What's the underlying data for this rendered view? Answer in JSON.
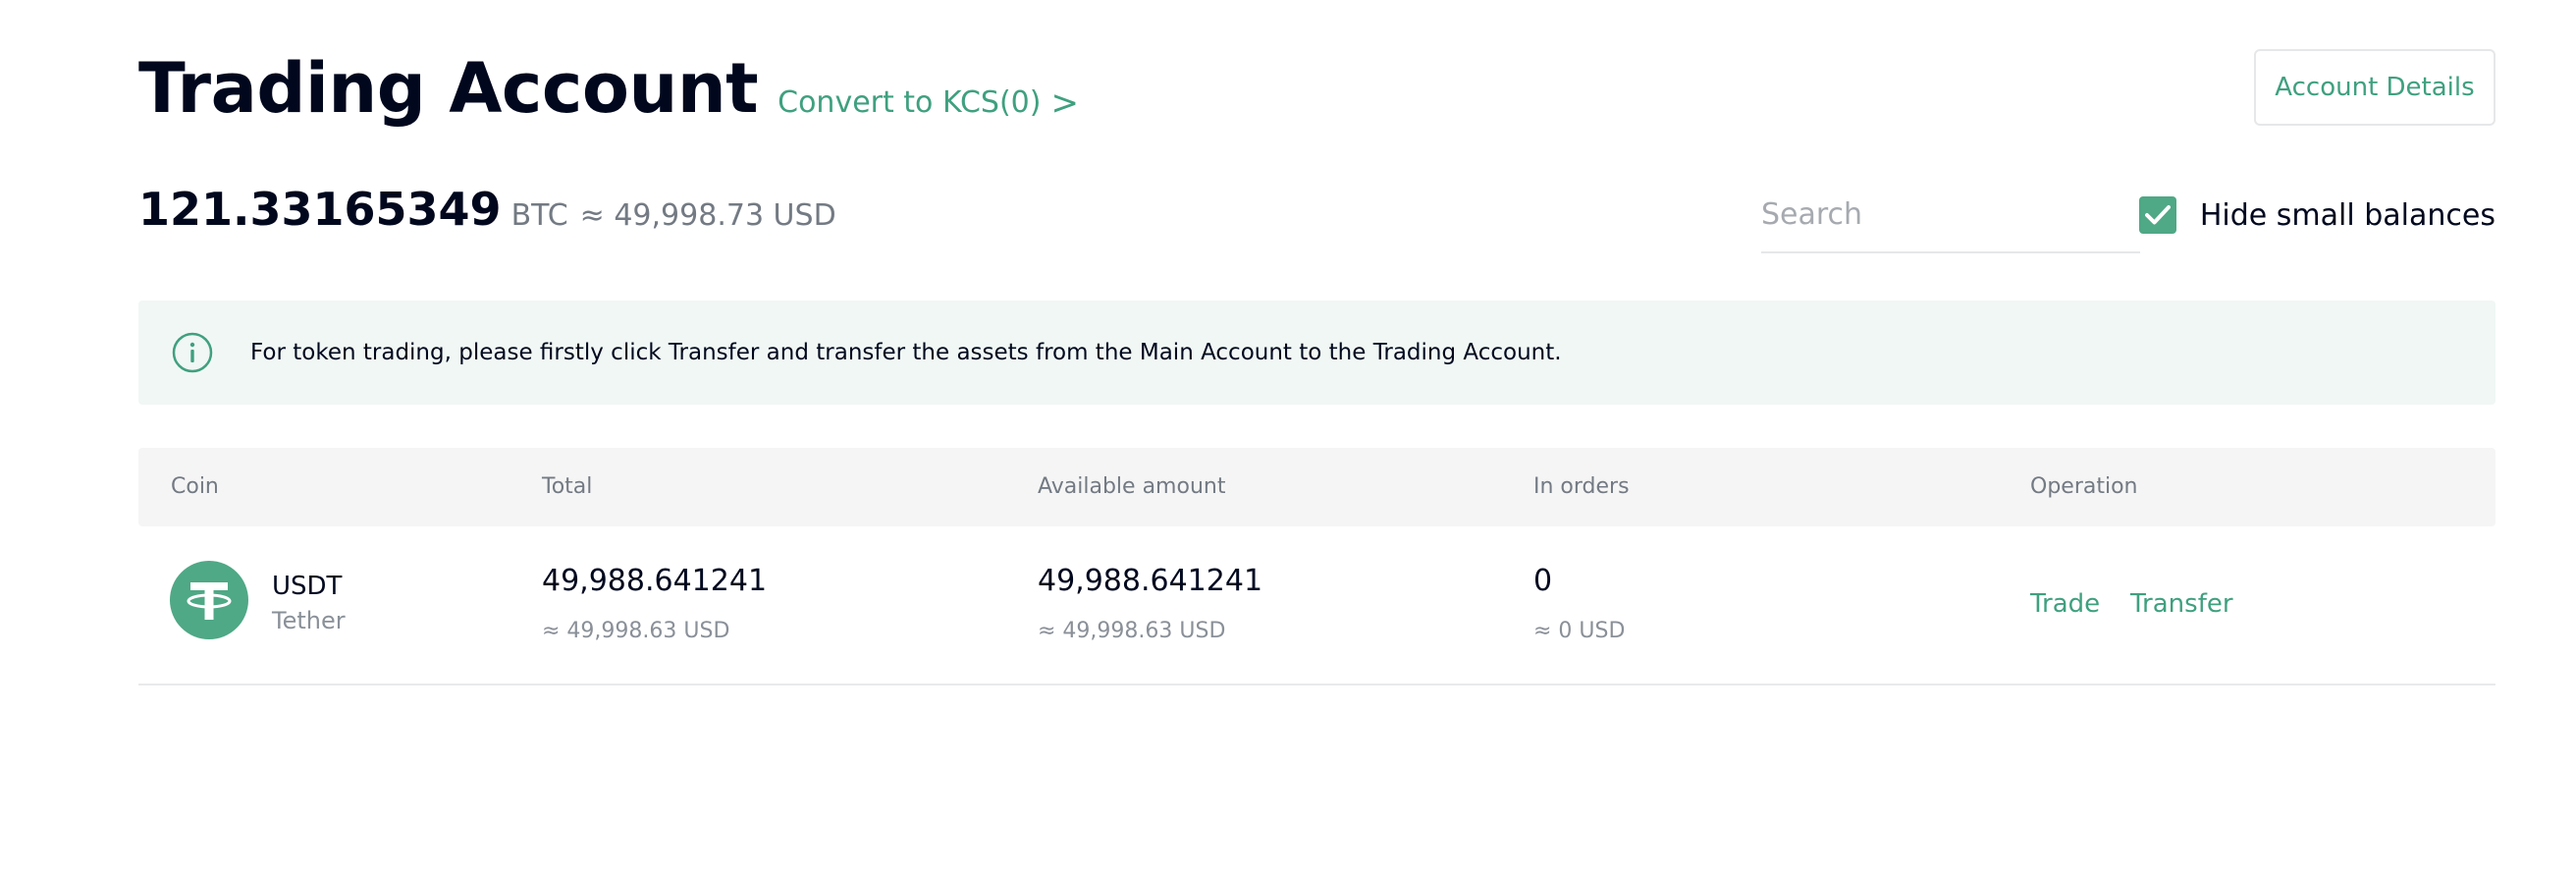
{
  "header": {
    "title": "Trading Account",
    "convert_label": "Convert to KCS(0)",
    "convert_chevron": ">",
    "account_details_label": "Account Details"
  },
  "balance": {
    "value": "121.33165349",
    "unit": "BTC",
    "fiat": "≈ 49,998.73 USD"
  },
  "search": {
    "placeholder": "Search",
    "value": ""
  },
  "hide_small_balances": {
    "label": "Hide small balances",
    "checked": true
  },
  "notice": {
    "icon": "info-icon",
    "text": "For token trading, please firstly click Transfer and transfer the assets from the Main Account to the Trading Account."
  },
  "table": {
    "columns": [
      "Coin",
      "Total",
      "Available amount",
      "In orders",
      "Operation"
    ],
    "rows": [
      {
        "symbol": "USDT",
        "name": "Tether",
        "icon": "tether-icon",
        "total": "49,988.641241",
        "total_fiat": "≈ 49,998.63 USD",
        "available": "49,988.641241",
        "available_fiat": "≈ 49,998.63 USD",
        "in_orders": "0",
        "in_orders_fiat": "≈ 0 USD",
        "operations": [
          "Trade",
          "Transfer"
        ]
      }
    ]
  },
  "colors": {
    "accent": "#3fa07f",
    "checkbox": "#4fa886",
    "notice_bg": "#f0f7f4",
    "header_bg": "#f5f5f5",
    "text_primary": "#01081e",
    "text_secondary": "#737a83"
  }
}
